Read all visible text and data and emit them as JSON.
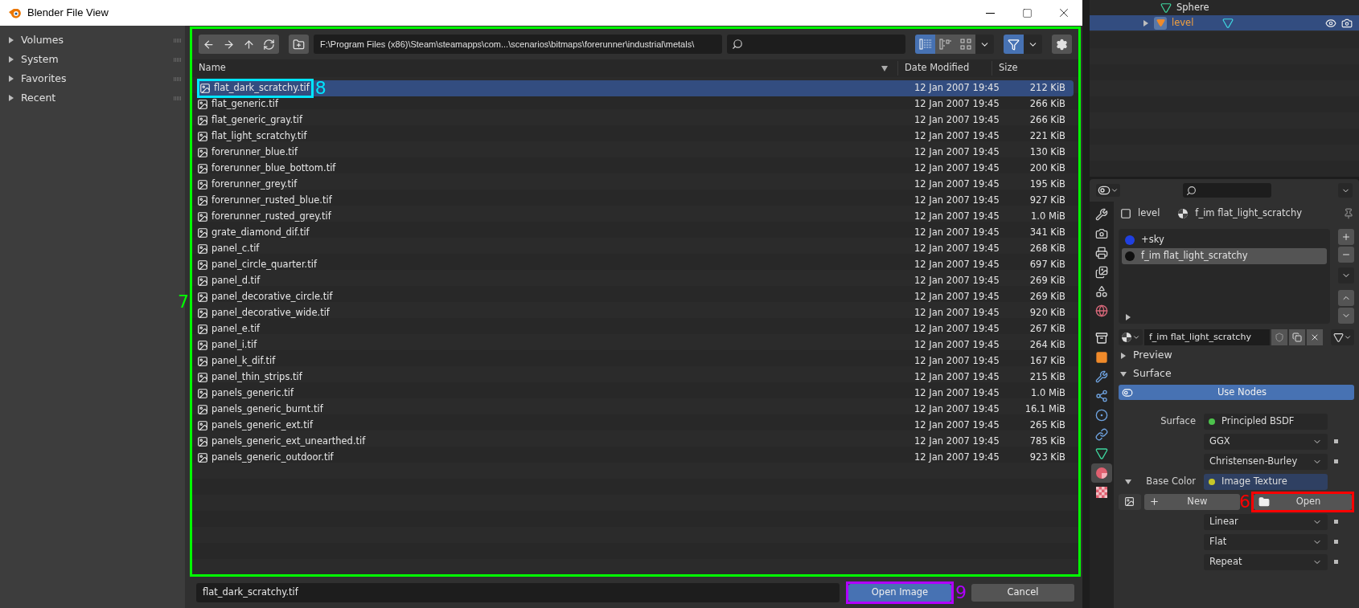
{
  "dialog": {
    "title": "Blender File View",
    "sidebar": [
      {
        "label": "Volumes",
        "expanded": false
      },
      {
        "label": "System",
        "expanded": false
      },
      {
        "label": "Favorites",
        "expanded": false
      },
      {
        "label": "Recent",
        "expanded": false
      }
    ],
    "toolbar": {
      "path": "F:\\Program Files (x86)\\Steam\\steamapps\\com...\\scenarios\\bitmaps\\forerunner\\industrial\\metals\\",
      "display_modes": [
        {
          "kind": "list",
          "selected": true
        },
        {
          "kind": "columns",
          "selected": false
        },
        {
          "kind": "grid",
          "selected": false
        }
      ],
      "filter_on": true
    },
    "annotation": {
      "label": "7",
      "color": "#00ff00"
    },
    "columns": [
      "Name",
      "Date Modified",
      "Size"
    ],
    "files": [
      {
        "name": "flat_dark_scratchy.tif",
        "date": "12 Jan 2007 19:45",
        "size": "212 KiB",
        "selected": true,
        "annotation": {
          "label": "8",
          "color": "#00e5ff"
        }
      },
      {
        "name": "flat_generic.tif",
        "date": "12 Jan 2007 19:45",
        "size": "266 KiB",
        "selected": false
      },
      {
        "name": "flat_generic_gray.tif",
        "date": "12 Jan 2007 19:45",
        "size": "266 KiB",
        "selected": false
      },
      {
        "name": "flat_light_scratchy.tif",
        "date": "12 Jan 2007 19:45",
        "size": "221 KiB",
        "selected": false
      },
      {
        "name": "forerunner_blue.tif",
        "date": "12 Jan 2007 19:45",
        "size": "130 KiB",
        "selected": false
      },
      {
        "name": "forerunner_blue_bottom.tif",
        "date": "12 Jan 2007 19:45",
        "size": "200 KiB",
        "selected": false
      },
      {
        "name": "forerunner_grey.tif",
        "date": "12 Jan 2007 19:45",
        "size": "195 KiB",
        "selected": false
      },
      {
        "name": "forerunner_rusted_blue.tif",
        "date": "12 Jan 2007 19:45",
        "size": "927 KiB",
        "selected": false
      },
      {
        "name": "forerunner_rusted_grey.tif",
        "date": "12 Jan 2007 19:45",
        "size": "1.0 MiB",
        "selected": false
      },
      {
        "name": "grate_diamond_dif.tif",
        "date": "12 Jan 2007 19:45",
        "size": "341 KiB",
        "selected": false
      },
      {
        "name": "panel_c.tif",
        "date": "12 Jan 2007 19:45",
        "size": "268 KiB",
        "selected": false
      },
      {
        "name": "panel_circle_quarter.tif",
        "date": "12 Jan 2007 19:45",
        "size": "697 KiB",
        "selected": false
      },
      {
        "name": "panel_d.tif",
        "date": "12 Jan 2007 19:45",
        "size": "269 KiB",
        "selected": false
      },
      {
        "name": "panel_decorative_circle.tif",
        "date": "12 Jan 2007 19:45",
        "size": "269 KiB",
        "selected": false
      },
      {
        "name": "panel_decorative_wide.tif",
        "date": "12 Jan 2007 19:45",
        "size": "920 KiB",
        "selected": false
      },
      {
        "name": "panel_e.tif",
        "date": "12 Jan 2007 19:45",
        "size": "267 KiB",
        "selected": false
      },
      {
        "name": "panel_i.tif",
        "date": "12 Jan 2007 19:45",
        "size": "264 KiB",
        "selected": false
      },
      {
        "name": "panel_k_dif.tif",
        "date": "12 Jan 2007 19:45",
        "size": "167 KiB",
        "selected": false
      },
      {
        "name": "panel_thin_strips.tif",
        "date": "12 Jan 2007 19:45",
        "size": "215 KiB",
        "selected": false
      },
      {
        "name": "panels_generic.tif",
        "date": "12 Jan 2007 19:45",
        "size": "1.0 MiB",
        "selected": false
      },
      {
        "name": "panels_generic_burnt.tif",
        "date": "12 Jan 2007 19:45",
        "size": "16.1 MiB",
        "selected": false
      },
      {
        "name": "panels_generic_ext.tif",
        "date": "12 Jan 2007 19:45",
        "size": "265 KiB",
        "selected": false
      },
      {
        "name": "panels_generic_ext_unearthed.tif",
        "date": "12 Jan 2007 19:45",
        "size": "785 KiB",
        "selected": false
      },
      {
        "name": "panels_generic_outdoor.tif",
        "date": "12 Jan 2007 19:45",
        "size": "923 KiB",
        "selected": false
      }
    ],
    "filename": "flat_dark_scratchy.tif",
    "buttons": [
      {
        "label": "Open Image",
        "kind": "primary",
        "annotation": {
          "label": "9",
          "color": "#b000ff"
        }
      },
      {
        "label": "Cancel",
        "kind": "default"
      }
    ]
  },
  "outliner": [
    {
      "name": "Sphere",
      "kind": "mesh",
      "selected": false
    },
    {
      "name": "level",
      "kind": "object",
      "selected": true
    }
  ],
  "properties": {
    "tab_groups": [
      [
        {
          "kind": "tool",
          "selected": false
        },
        {
          "kind": "render",
          "selected": false
        },
        {
          "kind": "output",
          "selected": false
        },
        {
          "kind": "view_layer",
          "selected": false
        },
        {
          "kind": "scene",
          "selected": false
        },
        {
          "kind": "world",
          "selected": false
        }
      ],
      [
        {
          "kind": "collection",
          "selected": false
        },
        {
          "kind": "object",
          "selected": false
        },
        {
          "kind": "modifier",
          "selected": false
        },
        {
          "kind": "particles",
          "selected": false
        },
        {
          "kind": "physics",
          "selected": false
        },
        {
          "kind": "constraint",
          "selected": false
        },
        {
          "kind": "data",
          "selected": false
        },
        {
          "kind": "material",
          "selected": true
        },
        {
          "kind": "texture",
          "selected": false
        }
      ]
    ],
    "breadcrumb": [
      "level",
      "f_im flat_light_scratchy"
    ],
    "slots": [
      {
        "name": "+sky",
        "color": "#2040e0",
        "selected": false
      },
      {
        "name": "f_im flat_light_scratchy",
        "color": "#101010",
        "selected": true
      }
    ],
    "material": "f_im flat_light_scratchy",
    "panels": [
      {
        "label": "Preview",
        "expanded": false
      },
      {
        "label": "Surface",
        "expanded": true
      }
    ],
    "use_nodes": "Use Nodes",
    "rows": [
      {
        "kind": "socket",
        "label": "Surface",
        "value": "Principled BSDF",
        "color": "#4cc24c"
      },
      {
        "kind": "dropdown",
        "value": "GGX"
      },
      {
        "kind": "dropdown",
        "value": "Christensen-Burley"
      },
      {
        "kind": "socket",
        "label": "Base Color",
        "value": "Image Texture",
        "color": "#c7c729",
        "expanded": true
      },
      {
        "kind": "image",
        "new": "New",
        "open": "Open",
        "annotation": {
          "label": "6",
          "color": "#ff0000"
        }
      },
      {
        "kind": "dropdown",
        "value": "Linear"
      },
      {
        "kind": "dropdown",
        "value": "Flat"
      },
      {
        "kind": "dropdown",
        "value": "Repeat"
      }
    ]
  }
}
